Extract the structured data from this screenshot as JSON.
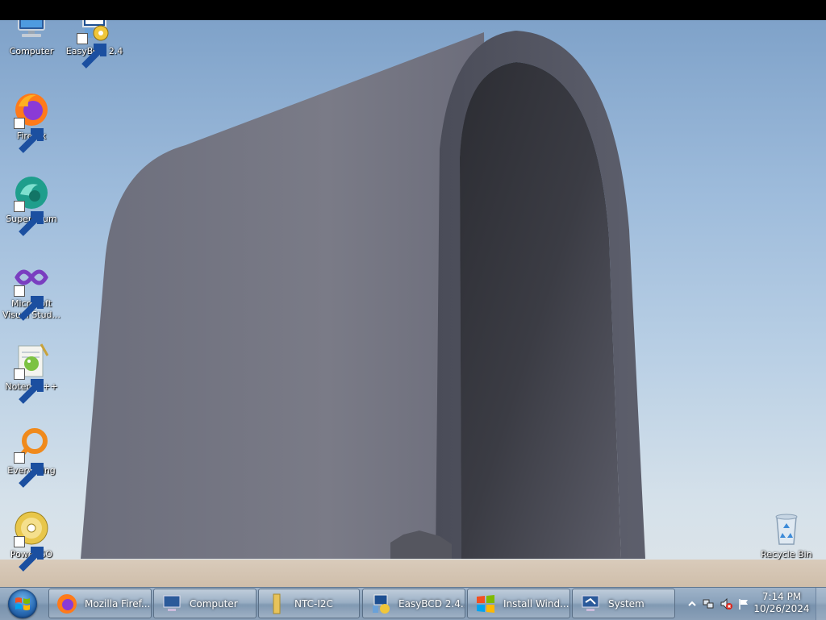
{
  "desktop_icons": [
    {
      "id": "computer",
      "label": "Computer",
      "icon": "computer-icon",
      "shortcut": false
    },
    {
      "id": "easybcd",
      "label": "EasyBCD 2.4",
      "icon": "easybcd-icon",
      "shortcut": true
    },
    {
      "id": "firefox",
      "label": "Firefox",
      "icon": "firefox-icon",
      "shortcut": true
    },
    {
      "id": "supermium",
      "label": "Supermium",
      "icon": "supermium-icon",
      "shortcut": true
    },
    {
      "id": "visualstudio",
      "label_line1": "Microsoft",
      "label_line2": "Visual Stud...",
      "icon": "visual-studio-icon",
      "shortcut": true
    },
    {
      "id": "notepadpp",
      "label": "Notepad++",
      "icon": "notepad-plus-plus-icon",
      "shortcut": true
    },
    {
      "id": "everything",
      "label": "Everything",
      "icon": "everything-search-icon",
      "shortcut": true
    },
    {
      "id": "poweriso",
      "label": "PowerISO",
      "icon": "poweriso-disc-icon",
      "shortcut": true
    },
    {
      "id": "recyclebin",
      "label": "Recycle Bin",
      "icon": "recycle-bin-icon",
      "shortcut": false
    }
  ],
  "taskbar": {
    "start_icon": "windows-logo-icon",
    "buttons": [
      {
        "label": "Mozilla Firef...",
        "icon": "firefox-icon"
      },
      {
        "label": "Computer",
        "icon": "computer-icon"
      },
      {
        "label": "NTC-I2C",
        "icon": "folder-icon"
      },
      {
        "label": "EasyBCD 2.4...",
        "icon": "easybcd-icon"
      },
      {
        "label": "Install Wind...",
        "icon": "windows-logo-icon"
      },
      {
        "label": "System",
        "icon": "system-icon"
      }
    ]
  },
  "tray": {
    "icons": [
      "show-hidden-icons-arrow",
      "network-icon",
      "volume-muted-icon",
      "action-center-flag-icon"
    ],
    "time": "7:14 PM",
    "date": "10/26/2024"
  },
  "colors": {
    "sky_top": "#7fa2c9",
    "sky_bottom": "#dde4e8",
    "arch": "#6e6f7d",
    "ground": "#d5c4b0",
    "taskbar": "#8aa2bb"
  }
}
